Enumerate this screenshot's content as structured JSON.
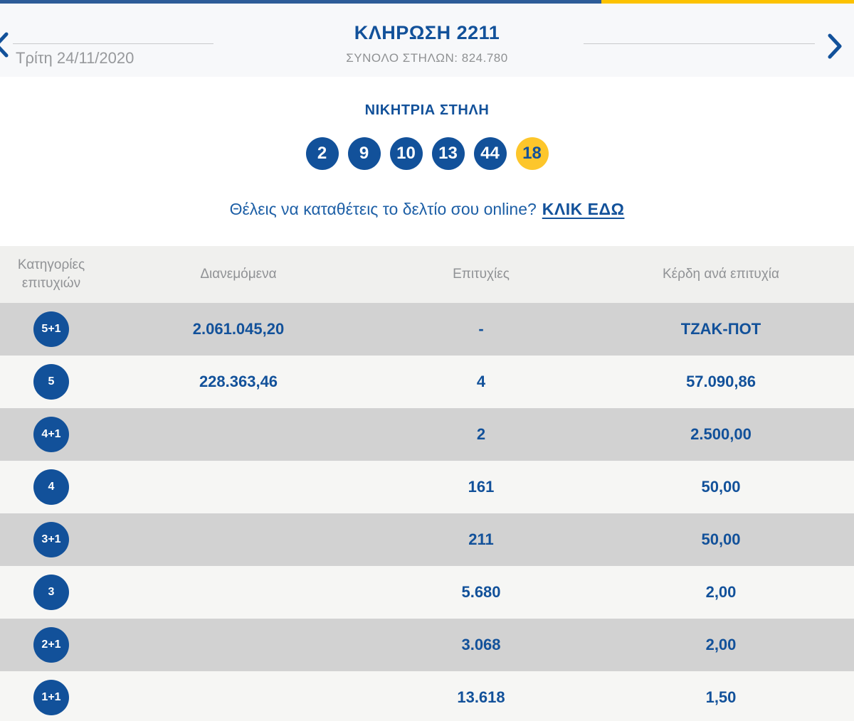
{
  "colors": {
    "accent_blue": "#2d5c98",
    "accent_yellow": "#fcc200",
    "ball_blue": "#12519a",
    "joker_yellow": "#fdc62b",
    "row_light": "#f6f6f4",
    "row_dark": "#d2d2d2"
  },
  "icons": {
    "prev": "chevron-left-icon",
    "next": "chevron-right-icon"
  },
  "header": {
    "date": "Τρίτη 24/11/2020",
    "title": "ΚΛΗΡΩΣΗ 2211",
    "subtitle": "ΣΥΝΟΛΟ ΣΤΗΛΩΝ: 824.780"
  },
  "winning": {
    "heading": "ΝΙΚΗΤΡΙΑ ΣΤΗΛΗ",
    "numbers": [
      "2",
      "9",
      "10",
      "13",
      "44"
    ],
    "joker": "18"
  },
  "cta": {
    "text": "Θέλεις να καταθέτεις το δελτίο σου online?",
    "link": "ΚΛΙΚ ΕΔΩ"
  },
  "table": {
    "headers": [
      "Κατηγορίες επιτυχιών",
      "Διανεμόμενα",
      "Επιτυχίες",
      "Κέρδη ανά επιτυχία"
    ],
    "rows": [
      {
        "category": "5+1",
        "distributed": "2.061.045,20",
        "winners": "-",
        "prize": "ΤΖΑΚ-ΠΟΤ"
      },
      {
        "category": "5",
        "distributed": "228.363,46",
        "winners": "4",
        "prize": "57.090,86"
      },
      {
        "category": "4+1",
        "distributed": "",
        "winners": "2",
        "prize": "2.500,00"
      },
      {
        "category": "4",
        "distributed": "",
        "winners": "161",
        "prize": "50,00"
      },
      {
        "category": "3+1",
        "distributed": "",
        "winners": "211",
        "prize": "50,00"
      },
      {
        "category": "3",
        "distributed": "",
        "winners": "5.680",
        "prize": "2,00"
      },
      {
        "category": "2+1",
        "distributed": "",
        "winners": "3.068",
        "prize": "2,00"
      },
      {
        "category": "1+1",
        "distributed": "",
        "winners": "13.618",
        "prize": "1,50"
      }
    ]
  }
}
